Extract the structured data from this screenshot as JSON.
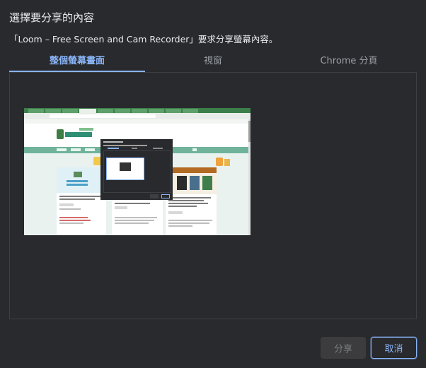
{
  "dialog": {
    "title": "選擇要分享的內容",
    "subtitle": "「Loom – Free Screen and Cam Recorder」要求分享螢幕內容。"
  },
  "tabs": [
    {
      "label": "整個螢幕畫面",
      "selected": true
    },
    {
      "label": "視窗",
      "selected": false
    },
    {
      "label": "Chrome 分頁",
      "selected": false
    }
  ],
  "sources": [
    {
      "kind": "screen"
    }
  ],
  "buttons": {
    "share_label": "分享",
    "share_enabled": false,
    "cancel_label": "取消"
  },
  "colors": {
    "background": "#292a2d",
    "accent": "#8ab4f8",
    "text": "#e8eaed",
    "muted": "#9aa0a6",
    "border": "#3c4043"
  }
}
